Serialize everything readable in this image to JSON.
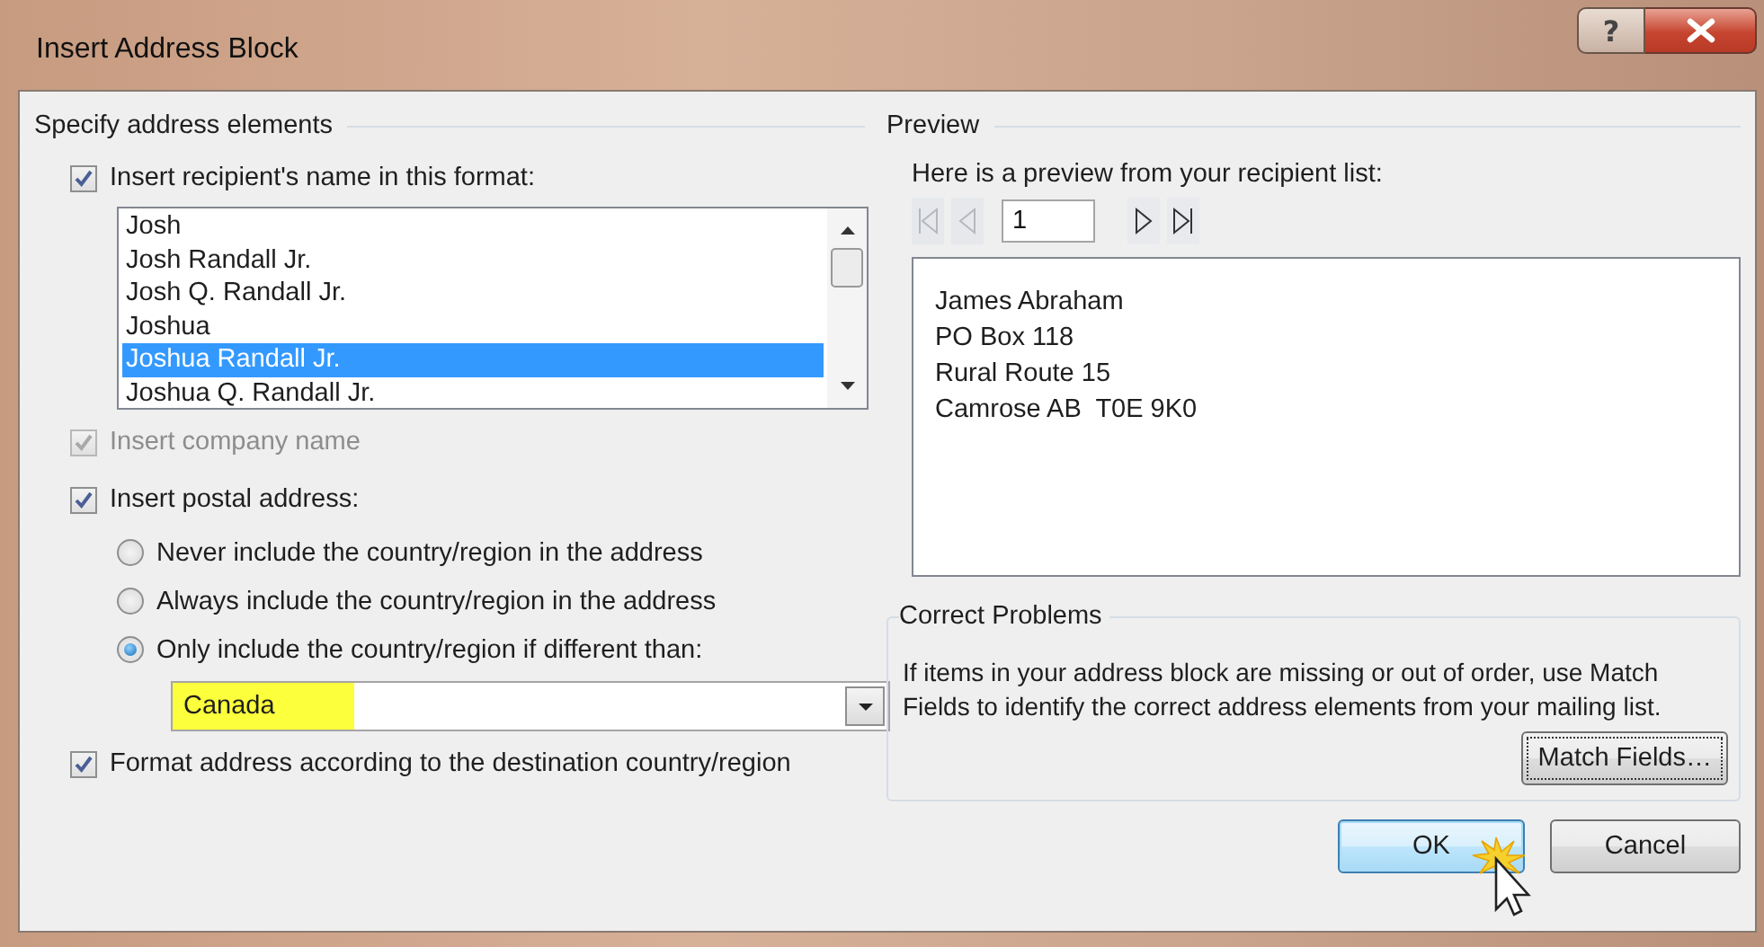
{
  "window": {
    "title": "Insert Address Block",
    "help": "?"
  },
  "elements": {
    "title": "Specify address elements",
    "name_format": {
      "label": "Insert recipient's name in this format:",
      "checked": true,
      "disabled": false
    },
    "name_list": [
      {
        "label": "Josh",
        "selected": false
      },
      {
        "label": "Josh Randall Jr.",
        "selected": false
      },
      {
        "label": "Josh Q. Randall Jr.",
        "selected": false
      },
      {
        "label": "Joshua",
        "selected": false
      },
      {
        "label": "Joshua Randall Jr.",
        "selected": true
      },
      {
        "label": "Joshua Q. Randall Jr.",
        "selected": false
      }
    ],
    "company": {
      "label": "Insert company name",
      "checked": true,
      "disabled": true
    },
    "postal": {
      "label": "Insert postal address:",
      "checked": true,
      "disabled": false
    },
    "country_options": [
      {
        "label": "Never include the country/region in the address",
        "selected": false
      },
      {
        "label": "Always include the country/region in the address",
        "selected": false
      },
      {
        "label": "Only include the country/region if different than:",
        "selected": true
      }
    ],
    "country": {
      "value": "Canada",
      "highlighted": true
    },
    "format": {
      "label": "Format address according to the destination country/region",
      "checked": true,
      "disabled": false
    }
  },
  "preview": {
    "title": "Preview",
    "intro": "Here is a preview from your recipient list:",
    "nav": [
      {
        "kind": "first",
        "disabled": true
      },
      {
        "kind": "previous",
        "disabled": true
      },
      {
        "kind": "record",
        "value": "1"
      },
      {
        "kind": "next",
        "disabled": false
      },
      {
        "kind": "last",
        "disabled": false
      }
    ],
    "address_lines": [
      "James Abraham",
      "PO Box 118",
      "Rural Route 15",
      "Camrose AB  T0E 9K0"
    ]
  },
  "correct": {
    "title": "Correct Problems",
    "text": "If items in your address block are missing or out of order, use Match Fields to identify the correct address elements from your mailing list.",
    "button": "Match Fields…"
  },
  "buttons": [
    {
      "label": "OK",
      "default": true
    },
    {
      "label": "Cancel",
      "default": false
    }
  ]
}
